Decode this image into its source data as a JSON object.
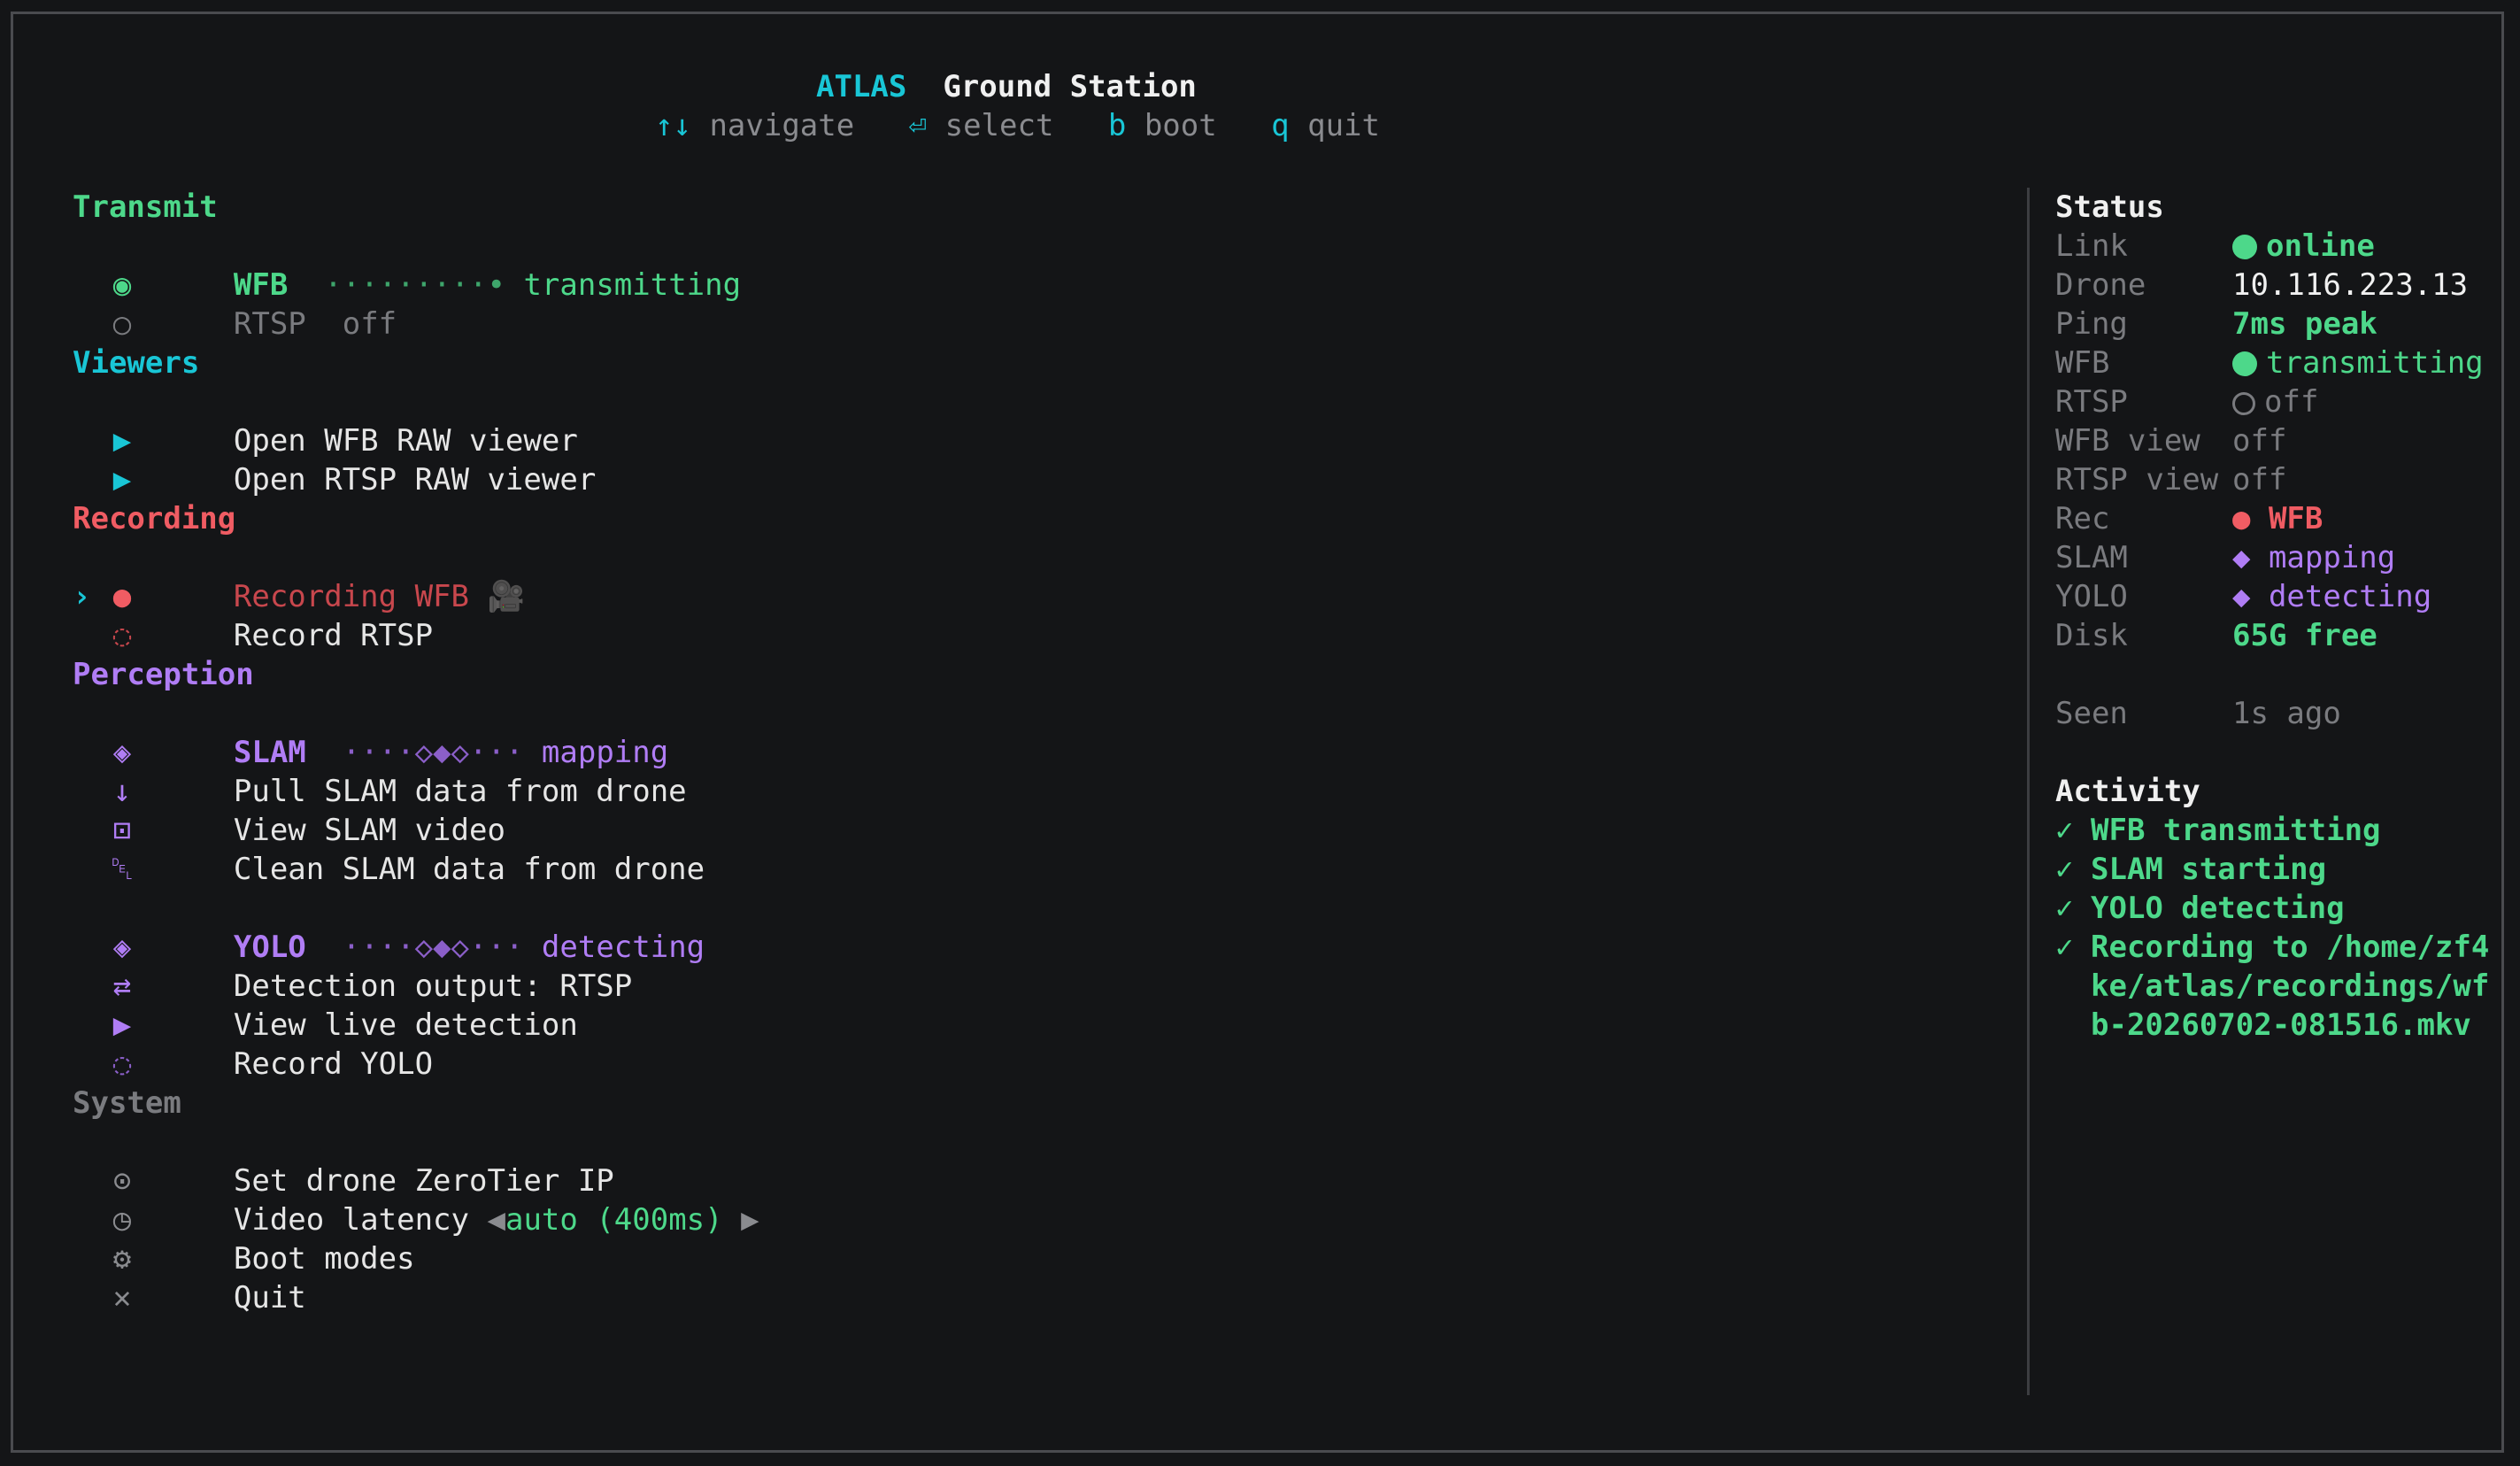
{
  "header": {
    "app_name": "ATLAS",
    "subtitle": "Ground Station",
    "keys": [
      {
        "key": "↑↓",
        "label": "navigate"
      },
      {
        "key": "⏎",
        "label": "select"
      },
      {
        "key": "b",
        "label": "boot"
      },
      {
        "key": "q",
        "label": "quit"
      }
    ]
  },
  "transmit": {
    "title": "Transmit",
    "wfb": {
      "label": "WFB",
      "dots": "·········•",
      "status": "transmitting"
    },
    "rtsp": {
      "label": "RTSP",
      "status": "off"
    }
  },
  "viewers": {
    "title": "Viewers",
    "items": [
      "Open WFB RAW viewer",
      "Open RTSP RAW viewer"
    ]
  },
  "recording": {
    "title": "Recording",
    "items": [
      "Recording WFB",
      "Record RTSP"
    ],
    "camera_glyph": "🎥"
  },
  "perception": {
    "title": "Perception",
    "slam": {
      "label": "SLAM",
      "dots": "····◇◆◇···",
      "status": "mapping"
    },
    "slam_items": [
      "Pull SLAM data from drone",
      "View SLAM video",
      "Clean SLAM data from drone"
    ],
    "yolo": {
      "label": "YOLO",
      "dots": "····◇◆◇···",
      "status": "detecting"
    },
    "yolo_items": [
      "Detection output: RTSP",
      "View live detection",
      "Record YOLO"
    ]
  },
  "system": {
    "title": "System",
    "items": [
      "Set drone ZeroTier IP",
      "Video latency",
      "Boot modes",
      "Quit"
    ],
    "latency_value": "auto (400ms)"
  },
  "status": {
    "title": "Status",
    "rows": [
      {
        "k": "Link",
        "v": "online"
      },
      {
        "k": "Drone",
        "v": "10.116.223.13"
      },
      {
        "k": "Ping",
        "v": "7ms peak"
      },
      {
        "k": "WFB",
        "v": "transmitting"
      },
      {
        "k": "RTSP",
        "v": "off"
      },
      {
        "k": "WFB view",
        "v": "off"
      },
      {
        "k": "RTSP view",
        "v": "off"
      },
      {
        "k": "Rec",
        "v": "WFB"
      },
      {
        "k": "SLAM",
        "v": "mapping"
      },
      {
        "k": "YOLO",
        "v": "detecting"
      },
      {
        "k": "Disk",
        "v": "65G free"
      },
      {
        "k": "Seen",
        "v": "1s ago"
      }
    ]
  },
  "activity": {
    "title": "Activity",
    "items": [
      "WFB transmitting",
      "SLAM starting",
      "YOLO detecting",
      "Recording to /home/zf4",
      "ke/atlas/recordings/wf",
      "b-20260702-081516.mkv"
    ]
  },
  "colors": {
    "background": "#141517",
    "cyan": "#19c6d6",
    "green": "#4dd88a",
    "red": "#f05c63",
    "purple": "#b07df5",
    "dim": "#7a7b7f"
  }
}
